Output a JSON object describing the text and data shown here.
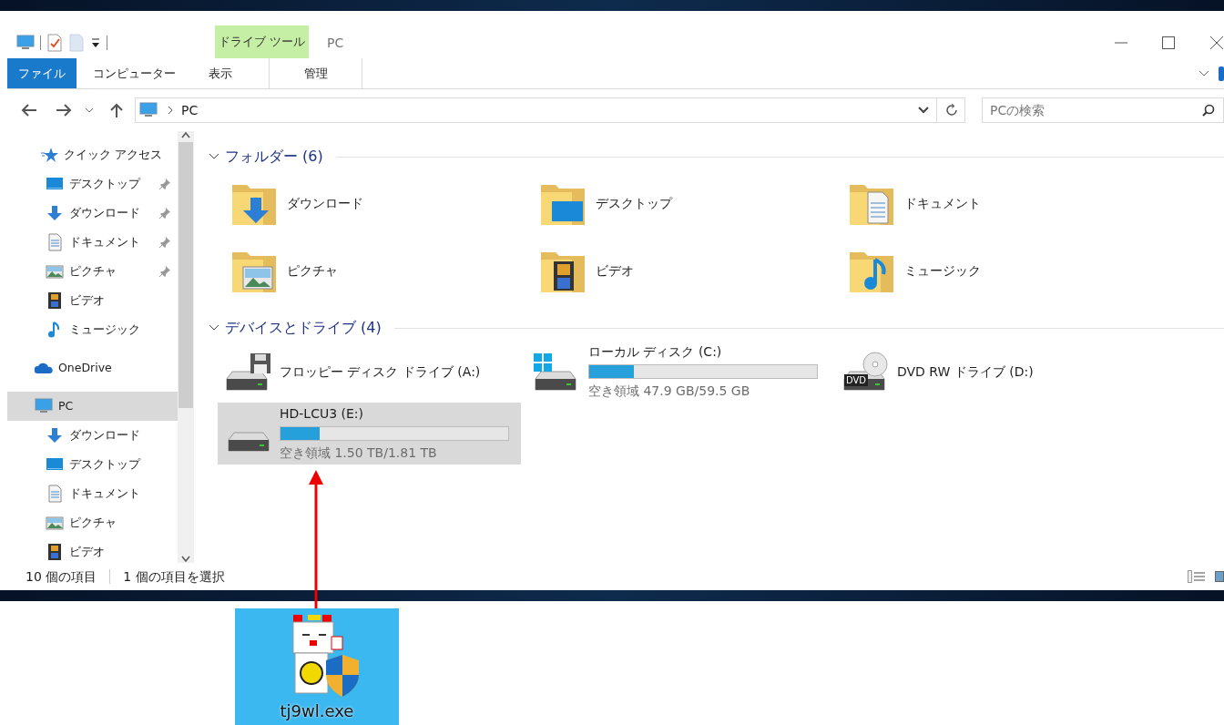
{
  "ribbon": {
    "context_group": "ドライブ ツール",
    "title": "PC",
    "tabs": [
      {
        "label": "ファイル",
        "kind": "file"
      },
      {
        "label": "コンピューター",
        "kind": "normal"
      },
      {
        "label": "表示",
        "kind": "normal"
      },
      {
        "label": "管理",
        "kind": "context"
      }
    ]
  },
  "address_bar": {
    "path": "PC"
  },
  "search": {
    "placeholder": "PCの検索"
  },
  "sidebar": {
    "items": [
      {
        "label": "クイック アクセス",
        "kind": "star",
        "selected": false,
        "children": [
          {
            "label": "デスクトップ",
            "kind": "desktop",
            "pinned": true,
            "selected": false
          },
          {
            "label": "ダウンロード",
            "kind": "download",
            "pinned": true,
            "selected": false
          },
          {
            "label": "ドキュメント",
            "kind": "documents",
            "pinned": true,
            "selected": false
          },
          {
            "label": "ピクチャ",
            "kind": "pictures",
            "pinned": true,
            "selected": false
          },
          {
            "label": "ビデオ",
            "kind": "videos",
            "pinned": false,
            "selected": false
          },
          {
            "label": "ミュージック",
            "kind": "music",
            "pinned": false,
            "selected": false
          }
        ]
      },
      {
        "label": "OneDrive",
        "kind": "cloud",
        "selected": false
      },
      {
        "label": "PC",
        "kind": "pc",
        "selected": true,
        "children": [
          {
            "label": "ダウンロード",
            "kind": "download",
            "pinned": false,
            "selected": false
          },
          {
            "label": "デスクトップ",
            "kind": "desktop",
            "pinned": false,
            "selected": false
          },
          {
            "label": "ドキュメント",
            "kind": "documents",
            "pinned": false,
            "selected": false
          },
          {
            "label": "ピクチャ",
            "kind": "pictures",
            "pinned": false,
            "selected": false
          },
          {
            "label": "ビデオ",
            "kind": "videos",
            "pinned": false,
            "selected": false
          }
        ]
      }
    ]
  },
  "sections": [
    {
      "title": "フォルダー (6)",
      "expanded": true,
      "kind": "folders",
      "items": [
        {
          "label": "ダウンロード",
          "kind": "download",
          "selected": false
        },
        {
          "label": "デスクトップ",
          "kind": "desktop",
          "selected": false
        },
        {
          "label": "ドキュメント",
          "kind": "documents",
          "selected": false
        },
        {
          "label": "ピクチャ",
          "kind": "pictures",
          "selected": false
        },
        {
          "label": "ビデオ",
          "kind": "videos",
          "selected": false
        },
        {
          "label": "ミュージック",
          "kind": "music",
          "selected": false
        }
      ]
    },
    {
      "title": "デバイスとドライブ (4)",
      "expanded": true,
      "kind": "drives",
      "items": [
        {
          "label": "フロッピー ディスク ドライブ (A:)",
          "kind": "floppy",
          "selected": false
        },
        {
          "label": "ローカル ディスク (C:)",
          "kind": "windows",
          "level": 0.195,
          "free": "空き領域 47.9 GB/59.5 GB",
          "selected": false
        },
        {
          "label": "DVD RW ドライブ (D:)",
          "kind": "dvd",
          "badge": "DVD",
          "selected": false
        },
        {
          "label": "HD-LCU3 (E:)",
          "kind": "disk",
          "level": 0.171,
          "free": "空き領域 1.50 TB/1.81 TB",
          "selected": true
        }
      ]
    }
  ],
  "status_bar": {
    "item_count": "10 個の項目",
    "selection": "1 個の項目を選択"
  },
  "desktop_icon": {
    "label": "tj9wl.exe",
    "selected": true
  }
}
